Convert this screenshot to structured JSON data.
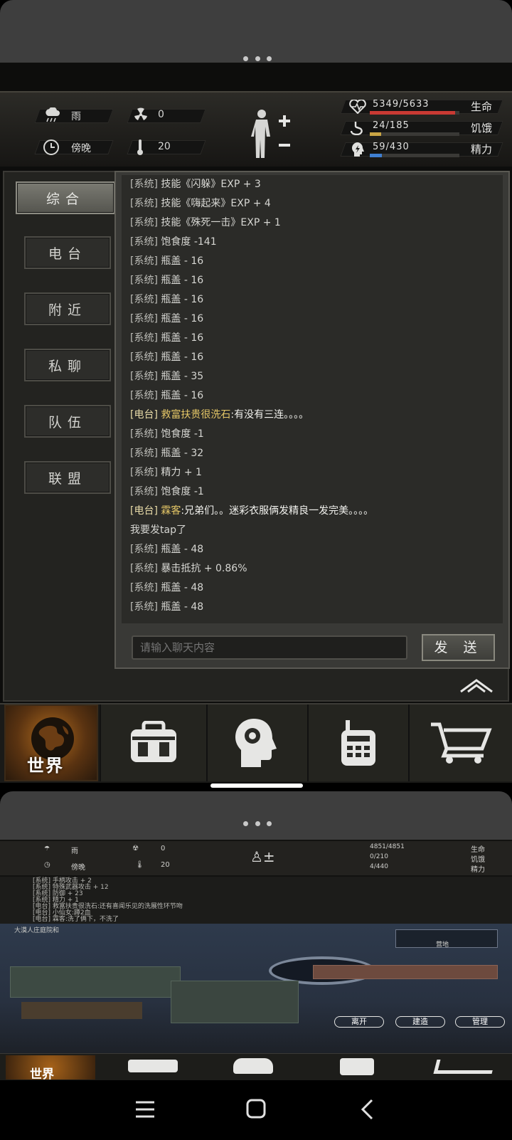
{
  "status": {
    "weather": "雨",
    "radiation": "0",
    "time_of_day": "傍晚",
    "temperature": "20",
    "health": {
      "text": "5349/5633",
      "label": "生命",
      "current": 5349,
      "max": 5633,
      "color": "#c93a33"
    },
    "hunger": {
      "text": "24/185",
      "label": "饥饿",
      "current": 24,
      "max": 185,
      "color": "#c9a544"
    },
    "energy": {
      "text": "59/430",
      "label": "精力",
      "current": 59,
      "max": 430,
      "color": "#3f7fd1"
    }
  },
  "tabs": [
    "综合",
    "电台",
    "附近",
    "私聊",
    "队伍",
    "联盟"
  ],
  "messages": [
    {
      "tag": "[系统]",
      "text": "技能《闪躲》EXP + 3"
    },
    {
      "tag": "[系统]",
      "text": "技能《嗨起来》EXP + 4"
    },
    {
      "tag": "[系统]",
      "text": "技能《殊死一击》EXP + 1"
    },
    {
      "tag": "[系统]",
      "text": "饱食度 -141"
    },
    {
      "tag": "[系统]",
      "text": "瓶盖 - 16"
    },
    {
      "tag": "[系统]",
      "text": "瓶盖 - 16"
    },
    {
      "tag": "[系统]",
      "text": "瓶盖 - 16"
    },
    {
      "tag": "[系统]",
      "text": "瓶盖 - 16"
    },
    {
      "tag": "[系统]",
      "text": "瓶盖 - 16"
    },
    {
      "tag": "[系统]",
      "text": "瓶盖 - 16"
    },
    {
      "tag": "[系统]",
      "text": "瓶盖 - 35"
    },
    {
      "tag": "[系统]",
      "text": "瓶盖 - 16"
    },
    {
      "tag": "[电台]",
      "name": "救富扶贵很洗石",
      "text": ":有没有三连。。。。"
    },
    {
      "tag": "[系统]",
      "text": "饱食度 -1"
    },
    {
      "tag": "[系统]",
      "text": "瓶盖 - 32"
    },
    {
      "tag": "[系统]",
      "text": "精力 + 1"
    },
    {
      "tag": "[系统]",
      "text": "饱食度 -1"
    },
    {
      "tag": "[电台]",
      "name": "霖客",
      "text": ":兄弟们。。迷彩衣服俩发精良一发完美。。。。"
    },
    {
      "tag": "",
      "text": "我要发tap了"
    },
    {
      "tag": "[系统]",
      "text": "瓶盖 - 48"
    },
    {
      "tag": "[系统]",
      "text": "暴击抵抗 + 0.86%"
    },
    {
      "tag": "[系统]",
      "text": "瓶盖 - 48"
    },
    {
      "tag": "[系统]",
      "text": "瓶盖 - 48"
    }
  ],
  "input": {
    "placeholder": "请输入聊天内容"
  },
  "send_label": "发 送",
  "nav": {
    "world_label": "世界"
  },
  "background_window": {
    "weather": "雨",
    "radiation": "0",
    "time_of_day": "傍晚",
    "temperature": "20",
    "health_text": "4851/4851",
    "health_label": "生命",
    "hunger_text": "0/210",
    "hunger_label": "饥饿",
    "energy_text": "4/440",
    "energy_label": "精力",
    "log": [
      "[系统] 手柄攻击 + 2",
      "[系统] 特殊武器攻击 + 12",
      "[系统] 防御 + 23",
      "[系统] 精力 + 1",
      "[电台] 救富扶贵很洗石:还有喜闻乐见的洗展性环节吻",
      "[电台] 小仙女:蹲2血",
      "[电台] 霖客:洗了俩下，不洗了"
    ],
    "location": "大漠人庄庭院和",
    "map_label": "营地",
    "buttons": [
      "离开",
      "建造",
      "管理"
    ],
    "nav_world_label": "世界"
  }
}
